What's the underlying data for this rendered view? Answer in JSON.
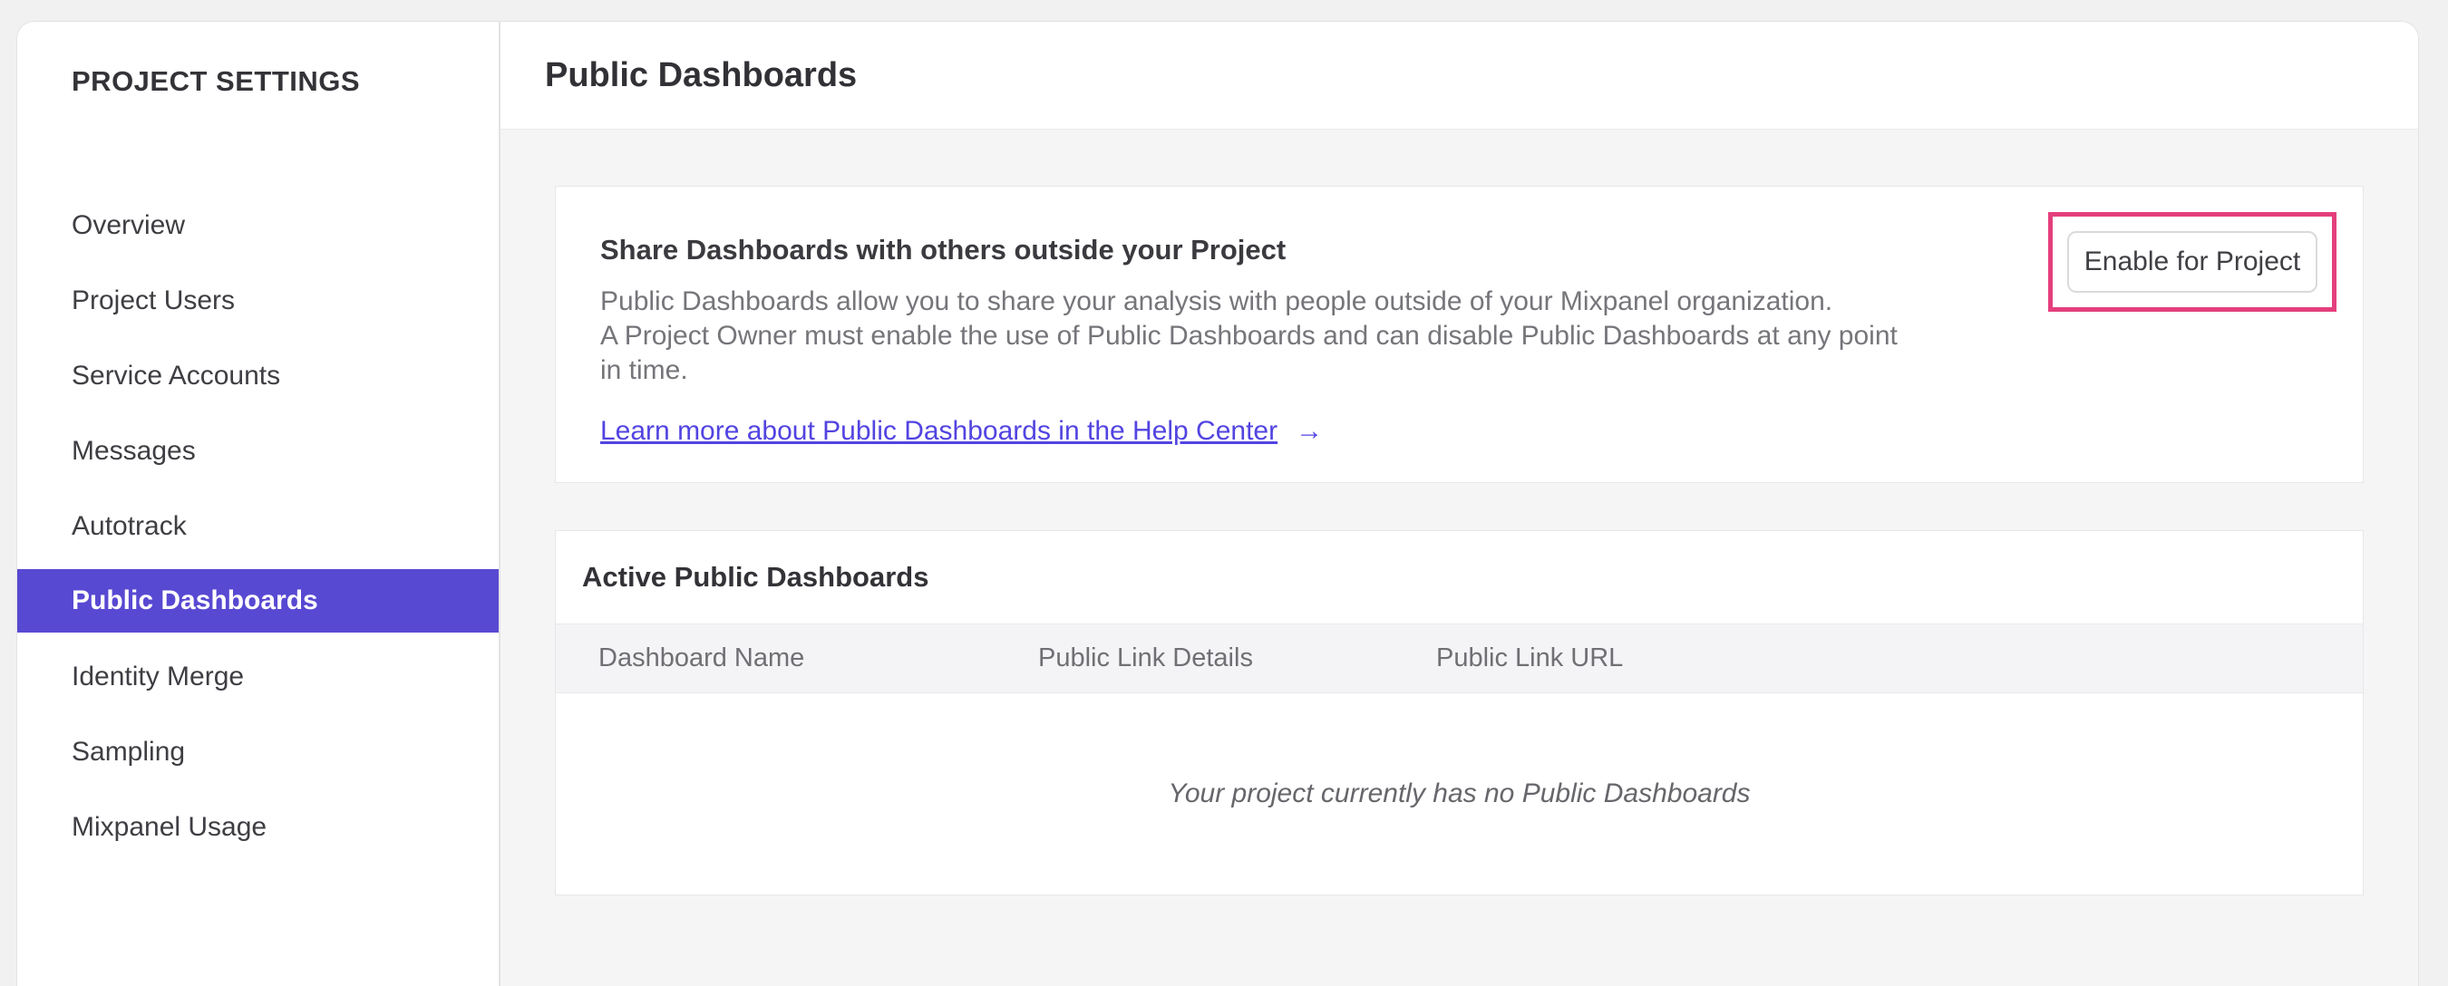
{
  "sidebar": {
    "title": "PROJECT SETTINGS",
    "items": [
      {
        "label": "Overview",
        "selected": false
      },
      {
        "label": "Project Users",
        "selected": false
      },
      {
        "label": "Service Accounts",
        "selected": false
      },
      {
        "label": "Messages",
        "selected": false
      },
      {
        "label": "Autotrack",
        "selected": false
      },
      {
        "label": "Public Dashboards",
        "selected": true
      },
      {
        "label": "Identity Merge",
        "selected": false
      },
      {
        "label": "Sampling",
        "selected": false
      },
      {
        "label": "Mixpanel Usage",
        "selected": false
      }
    ]
  },
  "header": {
    "title": "Public Dashboards"
  },
  "share_card": {
    "heading": "Share Dashboards with others outside your Project",
    "body_lines": [
      "Public Dashboards allow you to share your analysis with people outside of your Mixpanel organization.",
      "A Project Owner must enable the use of Public Dashboards and can disable Public Dashboards at any point",
      "in time."
    ],
    "link_label": "Learn more about Public Dashboards in the Help Center",
    "arrow": "→",
    "button_label": "Enable for Project"
  },
  "active_card": {
    "heading": "Active Public Dashboards",
    "columns": [
      "Dashboard Name",
      "Public Link Details",
      "Public Link URL"
    ],
    "empty_message": "Your project currently has no Public Dashboards"
  },
  "colors": {
    "accent_purple": "#5849d2",
    "link_purple": "#5244e1",
    "highlight_pink": "#e43f7d"
  }
}
